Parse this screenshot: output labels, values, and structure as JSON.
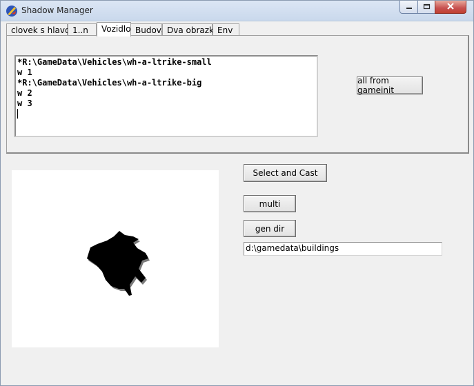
{
  "window": {
    "title": "Shadow Manager",
    "colors": {
      "close_button": "#c75050",
      "titlebar": "#dce6f4",
      "background": "#f0f0f0"
    }
  },
  "titlebar_buttons": {
    "minimize_icon": "minimize-icon",
    "maximize_icon": "maximize-icon",
    "close_icon": "close-icon"
  },
  "tabs": [
    {
      "label": "clovek s hlavou"
    },
    {
      "label": "1..n"
    },
    {
      "label": "Vozidlo",
      "active": true
    },
    {
      "label": "Budova"
    },
    {
      "label": "Dva obrazky"
    },
    {
      "label": "Env"
    }
  ],
  "editor": {
    "lines": [
      "*R:\\GameData\\Vehicles\\wh-a-ltrike-small",
      "w 1",
      "*R:\\GameData\\Vehicles\\wh-a-ltrike-big",
      "w 2",
      "w 3"
    ]
  },
  "buttons": {
    "all_from_gameinit": "all from gameinit",
    "select_and_cast": "Select and Cast",
    "multi": "multi",
    "gen_dir": "gen dir"
  },
  "path_field": {
    "value": "d:\\gamedata\\buildings"
  },
  "preview": {
    "content": "shadow-silhouette"
  }
}
